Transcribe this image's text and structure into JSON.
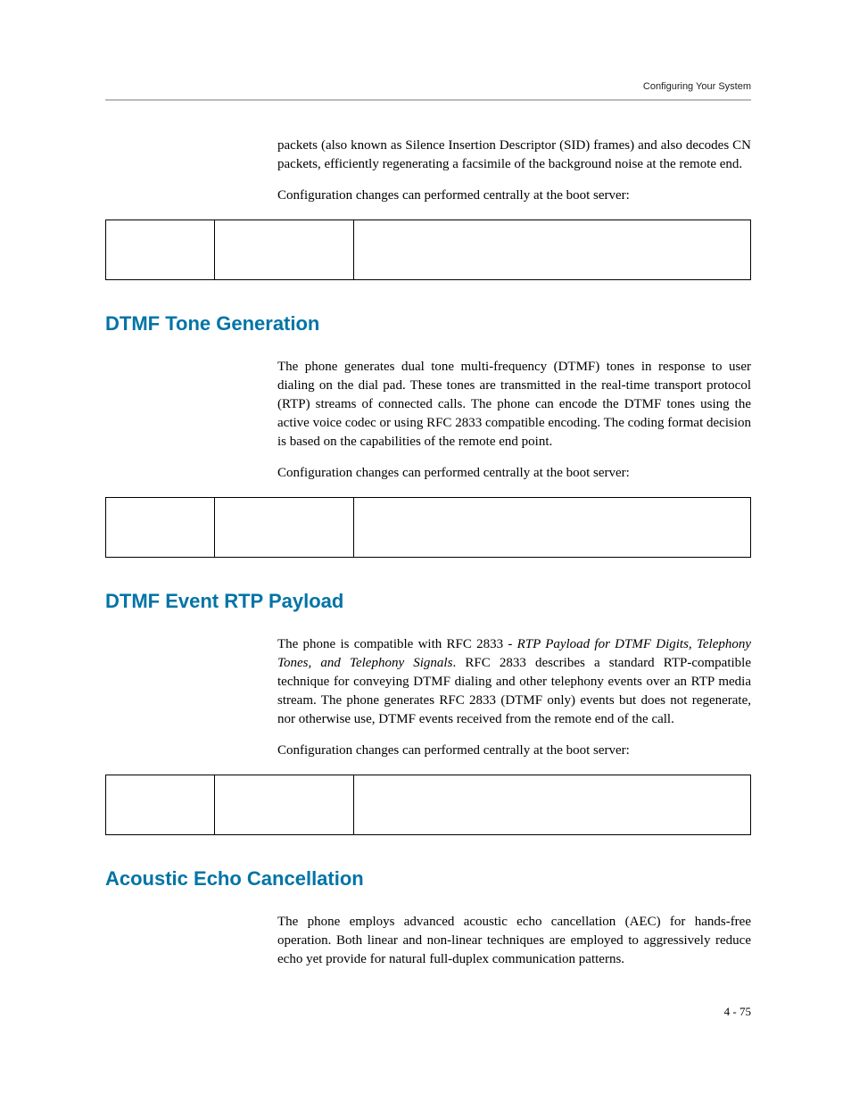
{
  "header": {
    "label": "Configuring Your System"
  },
  "intro": {
    "para1": "packets (also known as Silence Insertion Descriptor (SID) frames) and also decodes CN packets, efficiently regenerating a facsimile of the background noise at the remote end.",
    "para2": "Configuration changes can performed centrally at the boot server:"
  },
  "section1": {
    "heading": "DTMF Tone Generation",
    "para1": "The phone generates dual tone multi-frequency (DTMF) tones in response to user dialing on the dial pad. These tones are transmitted in the real-time transport protocol (RTP) streams of connected calls. The phone can encode the DTMF tones using the active voice codec or using RFC 2833 compatible encoding. The coding format decision is based on the capabilities of the remote end point.",
    "para2": "Configuration changes can performed centrally at the boot server:"
  },
  "section2": {
    "heading": "DTMF Event RTP Payload",
    "para1_pre": "The phone is compatible with RFC 2833 - ",
    "para1_italic": "RTP Payload for DTMF Digits, Telephony Tones, and Telephony Signals",
    "para1_post": ". RFC 2833 describes a standard RTP-compatible technique for conveying DTMF dialing and other telephony events over an RTP media stream. The phone generates RFC 2833 (DTMF only) events but does not regenerate, nor otherwise use, DTMF events received from the remote end of the call.",
    "para2": "Configuration changes can performed centrally at the boot server:"
  },
  "section3": {
    "heading": "Acoustic Echo Cancellation",
    "para1": "The phone employs advanced acoustic echo cancellation (AEC) for hands-free operation. Both linear and non-linear techniques are employed to aggressively reduce echo yet provide for natural full-duplex communication patterns."
  },
  "footer": {
    "page": "4 - 75"
  }
}
